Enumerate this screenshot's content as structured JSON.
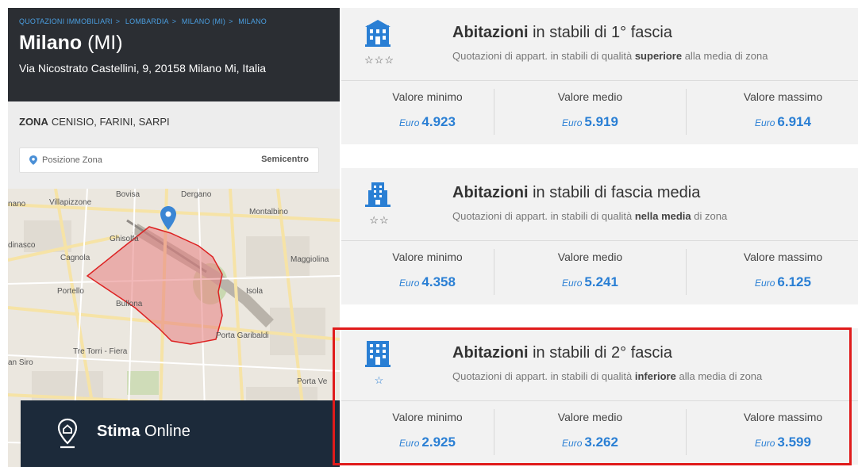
{
  "breadcrumb": [
    "QUOTAZIONI IMMOBILIARI",
    "LOMBARDIA",
    "MILANO (MI)",
    "MILANO"
  ],
  "breadcrumb_sep": ">",
  "city": {
    "name": "Milano",
    "province": "(MI)"
  },
  "address": "Via Nicostrato Castellini, 9, 20158 Milano Mi, Italia",
  "zona": {
    "label": "ZONA",
    "value": "CENISIO, FARINI, SARPI"
  },
  "position": {
    "label": "Posizione Zona",
    "value": "Semicentro"
  },
  "map_labels": {
    "bovisa": "Bovisa",
    "dergano": "Dergano",
    "villapizzone": "Villapizzone",
    "nano": "nano",
    "montalbino": "Montalbino",
    "ghisolfa": "Ghisolfa",
    "dinasco": "dinasco",
    "cagnola": "Cagnola",
    "maggiolina": "Maggiolina",
    "portello": "Portello",
    "isola": "Isola",
    "bullona": "Bullona",
    "porta_garibaldi": "Porta Garibaldi",
    "tre_torri": "Tre Torri - Fiera",
    "san_siro": "an Siro",
    "porta_ve": "Porta Ve"
  },
  "stima": {
    "bold": "Stima",
    "rest": "Online"
  },
  "currency": "Euro",
  "cards": [
    {
      "stars": "☆☆☆",
      "title_bold": "Abitazioni",
      "title_rest": "in stabili di 1° fascia",
      "sub_pre": "Quotazioni di appart. in stabili di qualità",
      "sub_bold": "superiore",
      "sub_post": "alla media di zona",
      "labels": [
        "Valore minimo",
        "Valore medio",
        "Valore massimo"
      ],
      "values": [
        "4.923",
        "5.919",
        "6.914"
      ]
    },
    {
      "stars": "☆☆",
      "title_bold": "Abitazioni",
      "title_rest": "in stabili di fascia media",
      "sub_pre": "Quotazioni di appart. in stabili di qualità",
      "sub_bold": "nella media",
      "sub_post": "di zona",
      "labels": [
        "Valore minimo",
        "Valore medio",
        "Valore massimo"
      ],
      "values": [
        "4.358",
        "5.241",
        "6.125"
      ]
    },
    {
      "stars": "☆",
      "title_bold": "Abitazioni",
      "title_rest": "in stabili di 2° fascia",
      "sub_pre": "Quotazioni di appart. in stabili di qualità",
      "sub_bold": "inferiore",
      "sub_post": "alla media di zona",
      "labels": [
        "Valore minimo",
        "Valore medio",
        "Valore massimo"
      ],
      "values": [
        "2.925",
        "3.262",
        "3.599"
      ]
    }
  ],
  "colors": {
    "accent_blue": "#2a7fd4",
    "header_dark": "#2b2e33",
    "highlight_red": "#e01b1b",
    "zone_fill": "#e88080"
  }
}
